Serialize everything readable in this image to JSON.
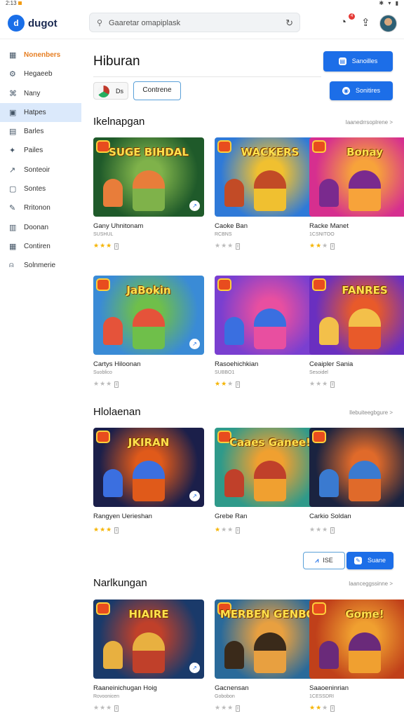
{
  "status": {
    "time": "2:13",
    "right_icons": "✱ ▾ ▮"
  },
  "header": {
    "logo": "d",
    "app_name": "dugot",
    "search_placeholder": "Gaaretar omapiplask",
    "badge_count": "4"
  },
  "sidebar": {
    "items": [
      {
        "label": "Nonenbers",
        "icon": "grid-icon"
      },
      {
        "label": "Hegaeeb",
        "icon": "gear-icon"
      },
      {
        "label": "Nany",
        "icon": "gamepad-icon"
      },
      {
        "label": "Hatpes",
        "icon": "window-icon"
      },
      {
        "label": "Barles",
        "icon": "bookmark-icon"
      },
      {
        "label": "Pailes",
        "icon": "puzzle-icon"
      },
      {
        "label": "Sonteoir",
        "icon": "chart-icon"
      },
      {
        "label": "Sontes",
        "icon": "card-icon"
      },
      {
        "label": "Rritonon",
        "icon": "pen-icon"
      },
      {
        "label": "Doonan",
        "icon": "doc-icon"
      },
      {
        "label": "Contiren",
        "icon": "calendar-icon"
      },
      {
        "label": "Solnmerie",
        "icon": "bell-icon"
      }
    ]
  },
  "main": {
    "title": "Hiburan",
    "top_button": "Sanoilles",
    "chip_label": "Ds",
    "outline_button": "Contrene",
    "secondary_button": "Sonitires"
  },
  "sections": [
    {
      "title": "Ikelnapgan",
      "link": "Iaanedrrsoplrene >",
      "cards": [
        {
          "name": "Gany Uhnitonam",
          "meta": "SUSHUL",
          "rating": 4,
          "thumb_title": "SUGE BIHDAL"
        },
        {
          "name": "Caoke Ban",
          "meta": "RCBNS",
          "rating": 0,
          "thumb_title": "WACKERS"
        },
        {
          "name": "Racke Manet",
          "meta": "1CSNITOO",
          "rating": 2,
          "thumb_title": "Bonay"
        },
        {
          "name": "Cartys Hiloonan",
          "meta": "Suoblico",
          "rating": 0,
          "thumb_title": "JaBokin"
        },
        {
          "name": "Rasoehichkian",
          "meta": "SUBBO1",
          "rating": 2,
          "thumb_title": ""
        },
        {
          "name": "Ceaipler Sania",
          "meta": "Sesoidel",
          "rating": 0,
          "thumb_title": "FANRES"
        }
      ]
    },
    {
      "title": "Hlolaenan",
      "link": "Ilebuiteegbgure >",
      "cards": [
        {
          "name": "Rangyen Uerieshan",
          "meta": "",
          "rating": 3,
          "thumb_title": "JKIRAN"
        },
        {
          "name": "Grebe Ran",
          "meta": "",
          "rating": 1,
          "thumb_title": "Caaes Ganee!"
        },
        {
          "name": "Carkio Soldan",
          "meta": "",
          "rating": 0,
          "thumb_title": ""
        }
      ]
    },
    {
      "title": "Narlkungan",
      "link": "Iaanceggssinne >",
      "cards": [
        {
          "name": "Raaneinichugan Hoig",
          "meta": "Rovoonicen",
          "rating": 0,
          "thumb_title": "HIAIRE"
        },
        {
          "name": "Gacnensan",
          "meta": "Gobobon",
          "rating": 0,
          "thumb_title": "MERBEN GENBO!"
        },
        {
          "name": "Saaoeninrian",
          "meta": "1CESSDRI",
          "rating": 2,
          "thumb_title": "Gome!"
        }
      ]
    }
  ],
  "mini_outline_label": "ISE",
  "mini_primary_label": "Suane",
  "colors": {
    "accent": "#1c6ee8",
    "active_bg": "#dbe9fb",
    "star": "#f5b400",
    "highlight": "#e67e22"
  }
}
